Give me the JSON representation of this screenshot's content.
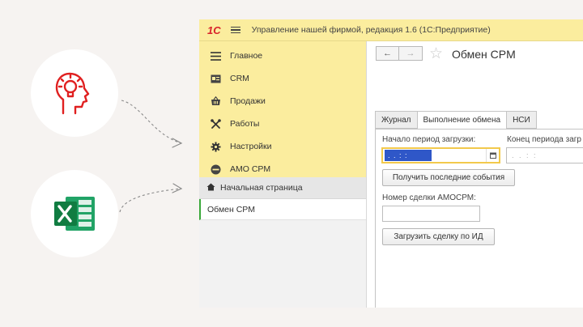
{
  "window": {
    "logo": "1С",
    "title": "Управление нашей фирмой, редакция 1.6  (1С:Предприятие)"
  },
  "sidebar": {
    "sections": [
      {
        "label": "Главное",
        "icon": "menu-lines-icon"
      },
      {
        "label": "CRM",
        "icon": "contact-card-icon"
      },
      {
        "label": "Продажи",
        "icon": "shop-basket-icon"
      },
      {
        "label": "Работы",
        "icon": "tools-icon"
      },
      {
        "label": "Настройки",
        "icon": "gear-icon"
      },
      {
        "label": "AMO CPM",
        "icon": "amo-badge-icon"
      }
    ],
    "home_label": "Начальная страница",
    "open_form_label": "Обмен CPM"
  },
  "form": {
    "title": "Обмен CPM",
    "back_glyph": "←",
    "forward_glyph": "→",
    "star_glyph": "☆",
    "tabs": [
      {
        "label": "Журнал",
        "active": false
      },
      {
        "label": "Выполнение обмена",
        "active": true
      },
      {
        "label": "НСИ",
        "active": false
      }
    ],
    "start_period_label": "Начало период загрузки:",
    "start_period_value": ". .   : :",
    "end_period_label": "Конец периода загр",
    "end_period_value": ". .   : :",
    "get_events_button": "Получить последние события",
    "deal_number_label": "Номер сделки АМОСРМ:",
    "deal_number_value": "",
    "load_deal_button": "Загрузить сделку по ИД"
  },
  "colors": {
    "sections_bg": "#fbed9e",
    "accent_red": "#e02020",
    "excel_green": "#21a366",
    "date_selection": "#2f57c8",
    "focus_border": "#f2c94c"
  }
}
